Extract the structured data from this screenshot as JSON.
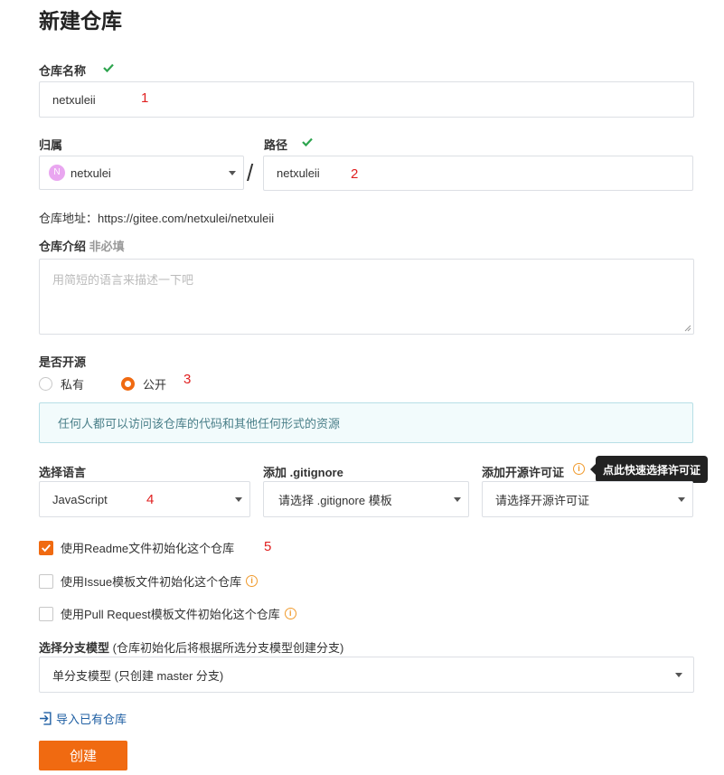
{
  "page": {
    "title": "新建仓库"
  },
  "repo_name": {
    "label": "仓库名称",
    "value": "netxuleii",
    "annotation": "1"
  },
  "owner": {
    "label": "归属",
    "avatar_letter": "N",
    "value": "netxulei"
  },
  "path": {
    "label": "路径",
    "separator": "/",
    "value": "netxuleii",
    "annotation": "2"
  },
  "address": {
    "label": "仓库地址：",
    "url": "https://gitee.com/netxulei/netxuleii"
  },
  "description": {
    "label": "仓库介绍",
    "optional": "非必填",
    "placeholder": "用简短的语言来描述一下吧"
  },
  "visibility": {
    "label": "是否开源",
    "options": [
      {
        "label": "私有",
        "selected": false
      },
      {
        "label": "公开",
        "selected": true
      }
    ],
    "annotation": "3",
    "notice": "任何人都可以访问该仓库的代码和其他任何形式的资源"
  },
  "language": {
    "label": "选择语言",
    "value": "JavaScript",
    "annotation": "4"
  },
  "gitignore": {
    "label": "添加 .gitignore",
    "value": "请选择 .gitignore 模板"
  },
  "license": {
    "label": "添加开源许可证",
    "value": "请选择开源许可证",
    "tooltip": "点此快速选择许可证"
  },
  "init_options": [
    {
      "label": "使用Readme文件初始化这个仓库",
      "checked": true,
      "annotation": "5"
    },
    {
      "label": "使用Issue模板文件初始化这个仓库",
      "checked": false
    },
    {
      "label": "使用Pull Request模板文件初始化这个仓库",
      "checked": false
    }
  ],
  "branch_model": {
    "label": "选择分支模型",
    "hint": "(仓库初始化后将根据所选分支模型创建分支)",
    "value": "单分支模型 (只创建 master 分支)"
  },
  "import_link": "导入已有仓库",
  "create_button": "创建",
  "colors": {
    "accent": "#f06a11",
    "success": "#2da44e",
    "info_bg": "#f2fbfc",
    "link": "#1f5fa3"
  }
}
